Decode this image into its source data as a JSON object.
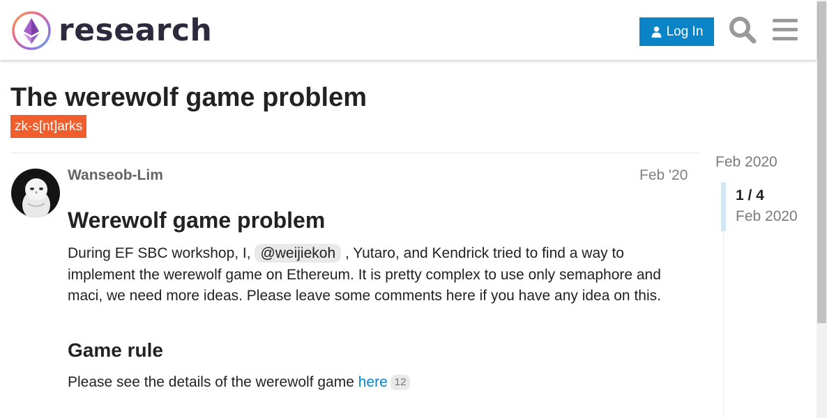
{
  "header": {
    "logo_text": "research",
    "login_label": "Log In"
  },
  "topic": {
    "title": "The werewolf game problem",
    "tag": "zk-s[nt]arks"
  },
  "post": {
    "username": "Wanseob-Lim",
    "date": "Feb '20",
    "heading": "Werewolf game problem",
    "para_before_mention": "During EF SBC workshop, I, ",
    "mention": "@weijiekoh",
    "para_after_mention": " , Yutaro, and Kendrick tried to find a way to implement the werewolf game on Ethereum. It is pretty complex to use only semaphore and maci, we need more ideas. Please leave some comments here if you have any idea on this.",
    "subheading": "Game rule",
    "rule_text": "Please see the details of the werewolf game ",
    "rule_link": "here",
    "rule_link_clicks": "12"
  },
  "timeline": {
    "start_date": "Feb 2020",
    "position": "1 / 4",
    "current_date": "Feb 2020"
  },
  "colors": {
    "accent": "#0a84c6",
    "tag": "#f05e2d",
    "text": "#222222",
    "muted": "#808080"
  },
  "icons": {
    "logo": "ethereum-logo-icon",
    "login": "user-icon",
    "search": "search-icon",
    "menu": "hamburger-menu-icon"
  }
}
